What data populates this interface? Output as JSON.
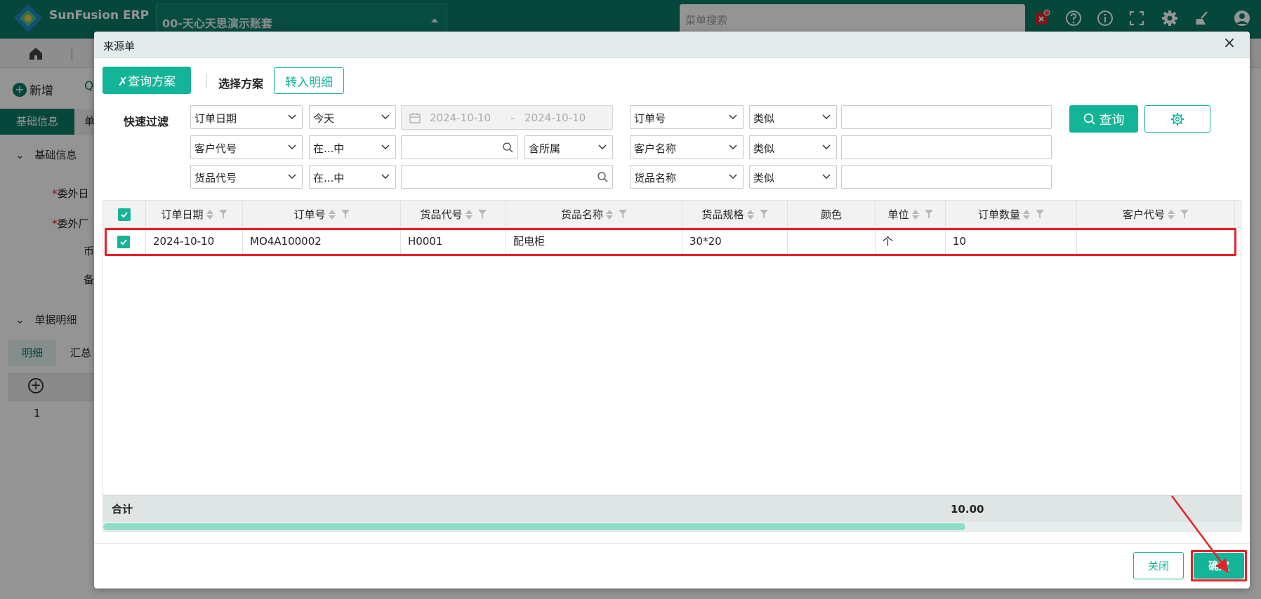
{
  "topbar": {
    "app_title": "SunFusion ERP",
    "account": "00-天心天思演示账套",
    "search_placeholder": "菜单搜索",
    "icons": [
      "notification-icon",
      "help-icon",
      "info-icon",
      "fullscreen-icon",
      "gear-icon",
      "broom-icon"
    ],
    "color": "#0c7a68"
  },
  "background_page": {
    "new_button": "新增",
    "tab_basic": "基础信息",
    "tab_second": "单",
    "section_basic": "基础信息",
    "field_1": "委外日",
    "field_2": "委外厂",
    "field_3": "币",
    "field_4": "备",
    "section_detail": "单据明细",
    "detail_tab_1": "明细",
    "detail_tab_2": "汇总",
    "row_index": "1"
  },
  "modal": {
    "title": "来源单",
    "toolbar": {
      "query_scheme": "查询方案",
      "select_scheme": "选择方案",
      "transfer_detail": "转入明细"
    },
    "filter": {
      "label": "快速过滤",
      "rows": [
        {
          "field": "订单日期",
          "op": "今天",
          "date_from": "2024-10-10",
          "date_sep": "-",
          "date_to": "2024-10-10",
          "field2": "订单号",
          "op2": "类似"
        },
        {
          "field": "客户代号",
          "op": "在...中",
          "extra": "含所属",
          "field2": "客户名称",
          "op2": "类似"
        },
        {
          "field": "货品代号",
          "op": "在...中",
          "field2": "货品名称",
          "op2": "类似"
        }
      ],
      "query_button": "查询"
    },
    "grid": {
      "columns": [
        "订单日期",
        "订单号",
        "货品代号",
        "货品名称",
        "货品规格",
        "颜色",
        "单位",
        "订单数量",
        "客户代号"
      ],
      "rows": [
        [
          "2024-10-10",
          "MO4A100002",
          "H0001",
          "配电柜",
          "30*20",
          "",
          "个",
          "10",
          ""
        ]
      ],
      "sum_label": "合计",
      "sum_qty": "10.00"
    },
    "footer": {
      "close": "关闭",
      "confirm": "确定"
    },
    "accent_color": "#13b497",
    "highlight_color": "#e8202a"
  }
}
